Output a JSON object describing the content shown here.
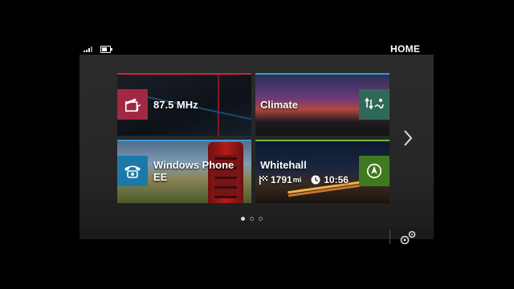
{
  "header": {
    "title": "HOME"
  },
  "status": {
    "signal_bars": 4,
    "battery_level": 0.7
  },
  "tiles": {
    "radio": {
      "label": "87.5 MHz",
      "icon": "media-clapper-icon",
      "accent": "#c8283a"
    },
    "climate": {
      "label": "Climate",
      "icon": "airflow-icon",
      "accent": "#3a9ad8"
    },
    "phone": {
      "label_line1": "Windows Phone",
      "label_line2": "EE",
      "icon": "telephone-icon",
      "accent": "#3a9ad8"
    },
    "navigation": {
      "label": "Whitehall",
      "distance": "1791",
      "distance_unit": "mi",
      "arrival_time": "10:56",
      "icon": "compass-arrow-icon",
      "accent": "#6fb83a"
    }
  },
  "pagination": {
    "pages": 3,
    "current": 1
  },
  "colors": {
    "radio_box": "#a02842",
    "climate_box": "#2f6a58",
    "phone_box": "#1d7aa8",
    "nav_box": "#3f7a1e"
  }
}
